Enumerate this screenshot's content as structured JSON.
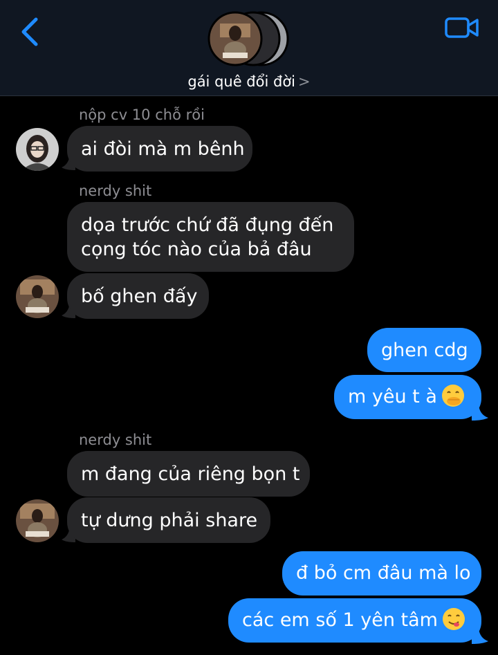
{
  "header": {
    "title": "gái quê đổi đời",
    "chevron": ">",
    "back_icon": "chevron-left-icon",
    "video_icon": "video-camera-icon",
    "accent": "#1f8bff"
  },
  "messages": [
    {
      "sender": "nộp cv 10 chỗ rồi",
      "text": "ai đòi mà m bênh"
    },
    {
      "sender": "nerdy shit",
      "text_line1": "dọa trước chứ đã đụng đến",
      "text_line2": "cọng tóc nào của bả đâu"
    },
    {
      "text": "bố ghen đấy"
    },
    {
      "text": "ghen cdg"
    },
    {
      "text": "m yêu t à"
    },
    {
      "sender": "nerdy shit",
      "text": "m đang của riêng bọn t"
    },
    {
      "text": "tự dưng phải share"
    },
    {
      "text": "đ bỏ cm đâu mà lo"
    },
    {
      "text": "các em số 1 yên tâm"
    }
  ],
  "colors": {
    "incoming_bubble": "#262628",
    "outgoing_bubble": "#1f8bff",
    "background": "#000000",
    "sender_name": "#8e8e93"
  }
}
